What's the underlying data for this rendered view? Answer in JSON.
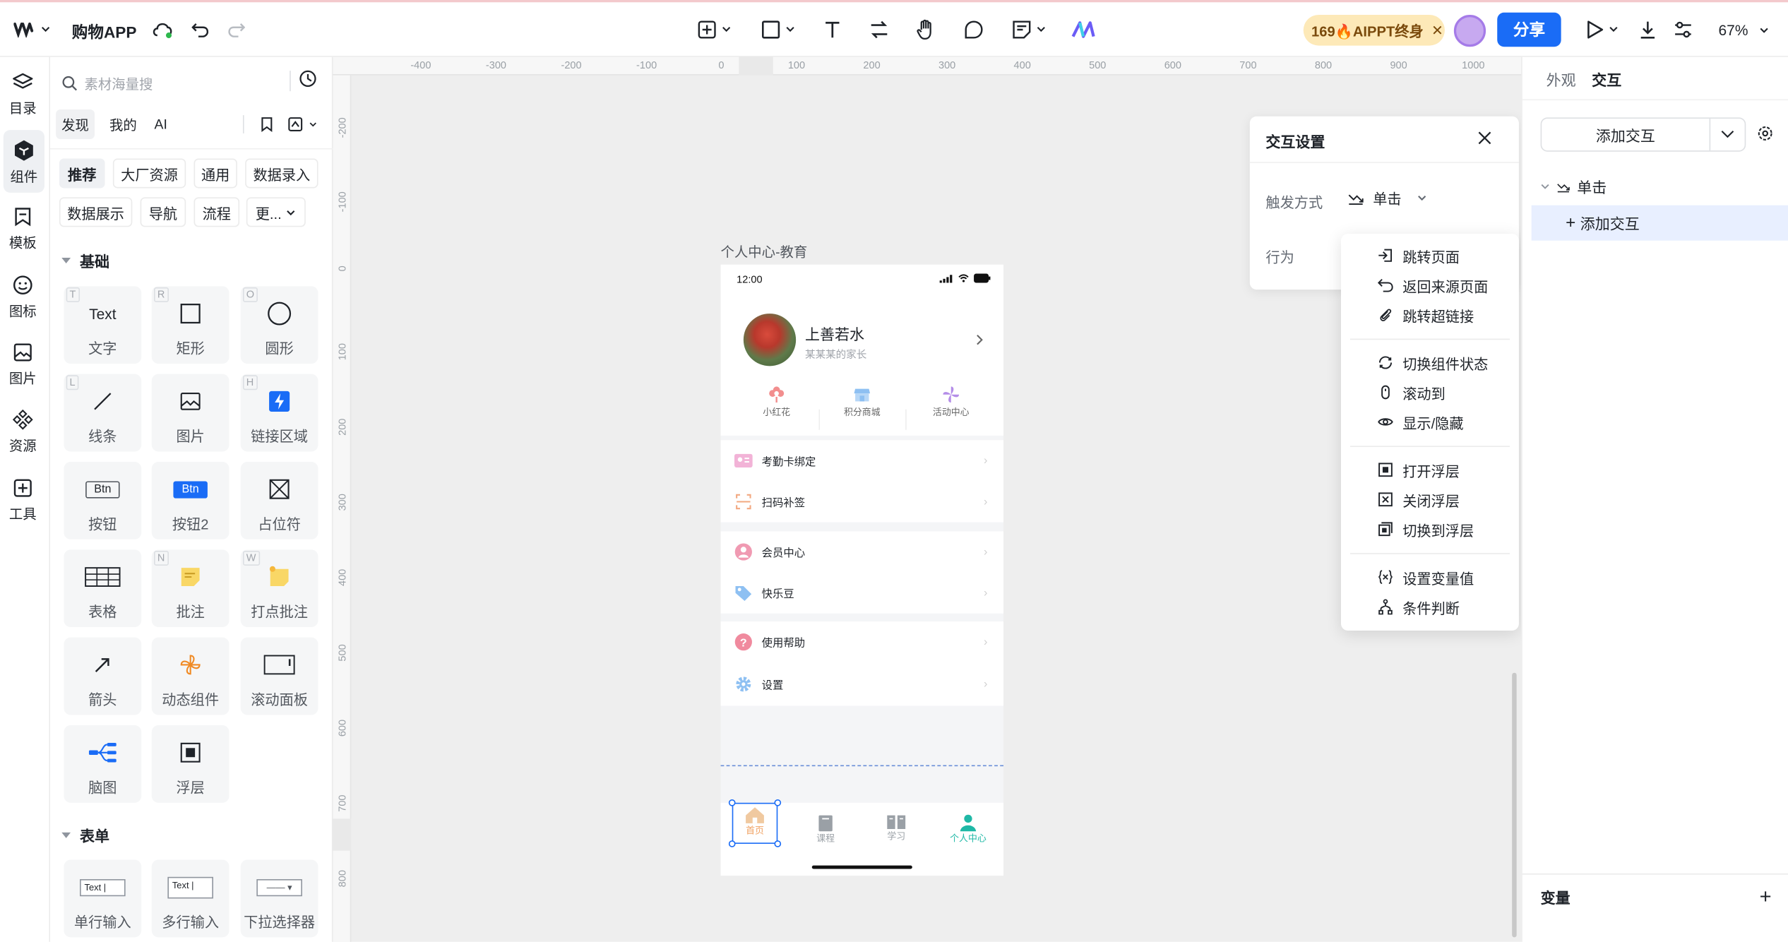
{
  "topbar": {
    "app_title": "购物APP",
    "promo_text": "169🔥AIPPT终身",
    "promo_close": "✕",
    "share_label": "分享",
    "zoom_label": "67%"
  },
  "rail": {
    "items": [
      {
        "label": "目录",
        "icon": "layers-icon"
      },
      {
        "label": "组件",
        "icon": "component-icon"
      },
      {
        "label": "模板",
        "icon": "bookmark-icon"
      },
      {
        "label": "图标",
        "icon": "smiley-icon"
      },
      {
        "label": "图片",
        "icon": "image-icon"
      },
      {
        "label": "资源",
        "icon": "resource-icon"
      },
      {
        "label": "工具",
        "icon": "tool-plus-icon"
      }
    ]
  },
  "library": {
    "search_placeholder": "素材海量搜",
    "tabs": [
      "发现",
      "我的",
      "AI"
    ],
    "chips_row1": [
      "推荐",
      "大厂资源",
      "通用",
      "数据录入"
    ],
    "chips_row2": [
      "数据展示",
      "导航",
      "流程",
      "更..."
    ],
    "section_basic": "基础",
    "section_form": "表单",
    "tiles": [
      {
        "label": "文字",
        "hotkey": "T",
        "glyph_text": "Text"
      },
      {
        "label": "矩形",
        "hotkey": "R"
      },
      {
        "label": "圆形",
        "hotkey": "O"
      },
      {
        "label": "线条",
        "hotkey": "L"
      },
      {
        "label": "图片",
        "hotkey": ""
      },
      {
        "label": "链接区域",
        "hotkey": "H"
      },
      {
        "label": "按钮",
        "hotkey": "",
        "glyph_text": "Btn"
      },
      {
        "label": "按钮2",
        "hotkey": "",
        "glyph_text": "Btn"
      },
      {
        "label": "占位符",
        "hotkey": ""
      },
      {
        "label": "表格",
        "hotkey": ""
      },
      {
        "label": "批注",
        "hotkey": "N"
      },
      {
        "label": "打点批注",
        "hotkey": "W"
      },
      {
        "label": "箭头",
        "hotkey": ""
      },
      {
        "label": "动态组件",
        "hotkey": ""
      },
      {
        "label": "滚动面板",
        "hotkey": ""
      },
      {
        "label": "脑图",
        "hotkey": ""
      },
      {
        "label": "浮层",
        "hotkey": ""
      }
    ],
    "form_tiles": [
      {
        "label": "单行输入",
        "glyph_text": "Text |"
      },
      {
        "label": "多行输入",
        "glyph_text": "Text |"
      },
      {
        "label": "下拉选择器",
        "glyph_text": "—— ▾"
      }
    ]
  },
  "canvas": {
    "ruler_h": [
      "-400",
      "-300",
      "-200",
      "-100",
      "0",
      "100",
      "200",
      "300",
      "400",
      "500",
      "600",
      "700",
      "800",
      "900",
      "1000"
    ],
    "ruler_v": [
      "-200",
      "-100",
      "0",
      "100",
      "200",
      "300",
      "400",
      "500",
      "600",
      "700",
      "800"
    ],
    "frame_label": "个人中心-教育",
    "phone": {
      "time": "12:00",
      "name": "上善若水",
      "subtitle": "某某某的家长",
      "quick": [
        "小红花",
        "积分商城",
        "活动中心"
      ],
      "rows_group1": [
        "考勤卡绑定",
        "扫码补签"
      ],
      "rows_group2": [
        "会员中心",
        "快乐豆"
      ],
      "rows_group3": [
        "使用帮助",
        "设置"
      ],
      "tabbar": [
        "首页",
        "课程",
        "学习",
        "个人中心"
      ]
    }
  },
  "popover": {
    "title": "交互设置",
    "trigger_label": "触发方式",
    "trigger_value": "单击",
    "action_label": "行为"
  },
  "menu": {
    "group1": [
      "跳转页面",
      "返回来源页面",
      "跳转超链接"
    ],
    "group2": [
      "切换组件状态",
      "滚动到",
      "显示/隐藏"
    ],
    "group3": [
      "打开浮层",
      "关闭浮层",
      "切换到浮层"
    ],
    "group4": [
      "设置变量值",
      "条件判断"
    ]
  },
  "right_panel": {
    "tab_appearance": "外观",
    "tab_interaction": "交互",
    "add_interaction": "添加交互",
    "tree_event": "单击",
    "tree_add": "添加交互",
    "variables_label": "变量",
    "variables_add": "+"
  }
}
